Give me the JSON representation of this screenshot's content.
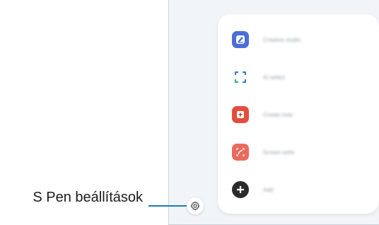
{
  "callout": {
    "label": "S Pen beállítások"
  },
  "colors": {
    "device_bg": "#f2f5f8",
    "accent_line": "#1c7ac2"
  },
  "air_command_menu": {
    "items": [
      {
        "label": "Creative studio",
        "icon": "creative-studio-icon",
        "color": "#4a6fd8"
      },
      {
        "label": "AI select",
        "icon": "ai-select-icon",
        "color": "#2f7ad1"
      },
      {
        "label": "Create note",
        "icon": "create-note-icon",
        "color": "#e44c3d"
      },
      {
        "label": "Screen write",
        "icon": "screen-write-icon",
        "color": "#ea6b5d"
      },
      {
        "label": "Add",
        "icon": "add-icon",
        "color": "#2b2b2b"
      }
    ]
  },
  "settings_button": {
    "icon": "gear-icon"
  }
}
